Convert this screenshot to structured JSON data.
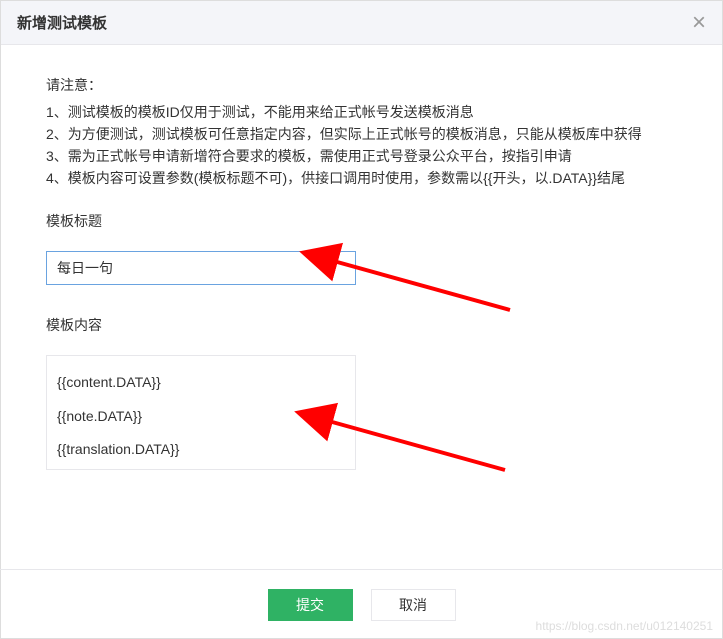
{
  "dialog": {
    "title": "新增测试模板",
    "close_symbol": "×"
  },
  "notice": {
    "heading": "请注意：",
    "items": [
      "1、测试模板的模板ID仅用于测试，不能用来给正式帐号发送模板消息",
      "2、为方便测试，测试模板可任意指定内容，但实际上正式帐号的模板消息，只能从模板库中获得",
      "3、需为正式帐号申请新增符合要求的模板，需使用正式号登录公众平台，按指引申请",
      "4、模板内容可设置参数(模板标题不可)，供接口调用时使用，参数需以{{开头，以.DATA}}结尾"
    ]
  },
  "form": {
    "title_label": "模板标题",
    "title_value": "每日一句",
    "content_label": "模板内容",
    "content_value": "{{content.DATA}}\n{{note.DATA}}\n{{translation.DATA}}"
  },
  "buttons": {
    "submit": "提交",
    "cancel": "取消"
  },
  "watermark": "https://blog.csdn.net/u012140251"
}
